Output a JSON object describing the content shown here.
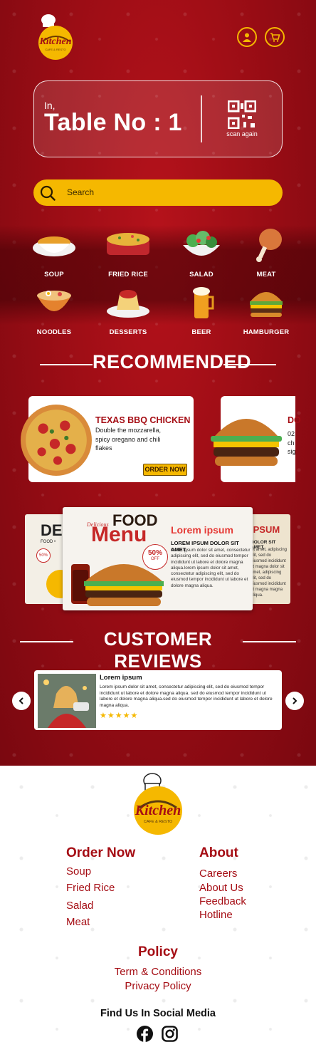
{
  "header": {
    "logo_text": "Kitchen",
    "logo_sub": "CAFE & RESTO",
    "profile_icon": "user-circle-icon",
    "cart_icon": "cart-icon"
  },
  "table": {
    "prefix": "In,",
    "label": "Table No : 1",
    "scan_label": "scan again"
  },
  "search": {
    "placeholder": "Search"
  },
  "categories": [
    {
      "label": "SOUP",
      "icon": "soup-icon"
    },
    {
      "label": "FRIED RICE",
      "icon": "fried-rice-icon"
    },
    {
      "label": "SALAD",
      "icon": "salad-icon"
    },
    {
      "label": "MEAT",
      "icon": "meat-icon"
    },
    {
      "label": "NOODLES",
      "icon": "noodles-icon"
    },
    {
      "label": "DESSERTS",
      "icon": "dessert-icon"
    },
    {
      "label": "BEER",
      "icon": "beer-icon"
    },
    {
      "label": "HAMBURGER",
      "icon": "hamburger-icon"
    }
  ],
  "recommended": {
    "title": "RECOMMENDED",
    "items": [
      {
        "title": "TEXAS BBQ CHICKEN",
        "desc": "Double the mozzarella, spicy oregano and chili flakes",
        "button": "ORDER NOW"
      },
      {
        "title": "DO",
        "desc_lines": [
          "02",
          "ch",
          "sig"
        ]
      }
    ]
  },
  "banners": {
    "left_text": "DEL",
    "left_sub": "FOOD •",
    "left_badge": "50%",
    "center": {
      "title_1": "FOOD",
      "title_2": "Menu",
      "script": "Delicious",
      "heading": "Lorem ipsum",
      "subheading": "LOREM IPSUM DOLOR SIT AMET,",
      "body": "lorem ipsum dolor sit amet, consectetur adipiscing elit, sed do eiusmod tempor incididunt ut labore et dolore magna aliqua.lorem ipsum dolor sit amet, consectetur adipiscing elit, sed do eiusmod tempor incididunt ut labore et dolore magna aliqua.",
      "badge": "50%",
      "badge_sub": "OFF"
    },
    "right_text": "IPSUM",
    "right_sub": "DOLOR SIT AMET,",
    "right_body": "sit amet, adipiscing elit, sed do eiusmod incididunt ut magna dolor sit amet, adipiscing elit, sed do eiusmod incididunt ut magna magna aliqua."
  },
  "reviews": {
    "title": "CUSTOMER REVIEWS",
    "items": [
      {
        "name": "Lorem ipsum",
        "text": "Lorem ipsum dolor sit amet, consectetur adipiscing elit, sed do eiusmod tempor incididunt ut labore et dolore magna aliqua. sed do eiusmod tempor incididunt ut labore et dolore magna aliqua.sed do eiusmod tempor incididunt ut labore et dolore magna aliqua.",
        "rating": 5
      }
    ]
  },
  "footer": {
    "logo_text": "Kitchen",
    "logo_sub": "CAFE & RESTO",
    "order_now": {
      "heading": "Order Now",
      "links": [
        "Soup",
        "Fried Rice",
        "Salad",
        "Meat"
      ]
    },
    "about": {
      "heading": "About",
      "links": [
        "Careers",
        "About Us",
        "Feedback",
        "Hotline"
      ]
    },
    "policy": {
      "heading": "Policy",
      "links": [
        "Term & Conditions",
        "Privacy Policy"
      ]
    },
    "social": {
      "heading": "Find Us In Social Media",
      "icons": [
        "facebook-icon",
        "instagram-icon"
      ]
    }
  },
  "colors": {
    "primary_red": "#a50d14",
    "accent_yellow": "#f5b800",
    "white": "#ffffff"
  }
}
